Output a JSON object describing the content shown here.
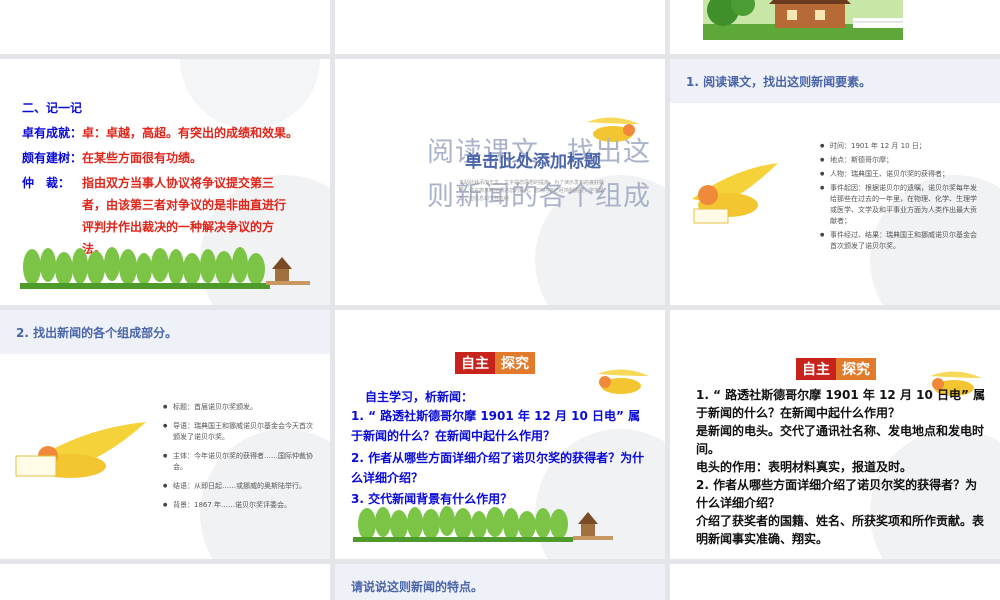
{
  "s3_note": "",
  "s4": {
    "heading": "二、记一记",
    "rows": [
      {
        "term": "卓有成就：",
        "def": "卓：卓越，高超。有突出的成绩和效果。"
      },
      {
        "term": "颇有建树：",
        "def": "在某些方面很有功绩。"
      },
      {
        "term": "仲　裁：",
        "def": "指由双方当事人协议将争议提交第三者，由该第三者对争议的是非曲直进行评判并作出裁决的一种解决争议的方法。"
      }
    ]
  },
  "s5": {
    "big_title": "阅读课文，找出这则新闻的各个组成",
    "click_title": "单击此处添加标题",
    "small_text": "本站此处添加正文，文字是您思想的提炼，为了演示发布的良好效果，请言简意赅地阐述您的观点。您的内容已经简明扼要，字字珠玑，但信息却千丝万缕"
  },
  "s6": {
    "title": "1. 阅读课文，找出这则新闻要素。",
    "bullets": [
      "时间：1901 年 12 月 10 日；",
      "地点：斯德哥尔摩；",
      "人物：瑞典国王、诺贝尔奖的获得者；",
      "事件起因：根据诺贝尔的遗嘱，诺贝尔奖每年发给那些在过去的一年里，在物理、化学、生理学或医学、文学及和平事业方面为人类作出最大贡献者；",
      "事件经过、结果：瑞典国王和挪威诺贝尔基金会首次颁发了诺贝尔奖。"
    ]
  },
  "s7": {
    "title": "2. 找出新闻的各个组成部分。",
    "bullets": [
      "标题：首届诺贝尔奖颁发。",
      "导语：瑞典国王和挪威诺贝尔基金会今天首次颁发了诺贝尔奖。",
      "主体：今年诺贝尔奖的获得者……国际仲裁协会。",
      "结语：从即日起……或挪威的奥斯陆举行。",
      "背景：1867 年……诺贝尔奖评委会。"
    ]
  },
  "s8": {
    "tag1": "自主",
    "tag2": "探究",
    "intro": "自主学习，析新闻：",
    "q1": "1. “ 路透社斯德哥尔摩  1901 年 12 月 10 日电” 属于新闻的什么？在新闻中起什么作用？",
    "q2": "2. 作者从哪些方面详细介绍了诺贝尔奖的获得者？为什么详细介绍？",
    "q3": "3. 交代新闻背景有什么作用？"
  },
  "s9": {
    "tag1": "自主",
    "tag2": "探究",
    "q1": "1. “ 路透社斯德哥尔摩  1901 年 12 月 10 日电” 属于新闻的什么？在新闻中起什么作用？",
    "a1": "是新闻的电头。交代了通讯社名称、发电地点和发电时间。",
    "a1b": "电头的作用：表明材料真实，报道及时。",
    "q2": "2. 作者从哪些方面详细介绍了诺贝尔奖的获得者？为什么详细介绍？",
    "a2": "介绍了获奖者的国籍、姓名、所获奖项和所作贡献。表明新闻事实准确、翔实。"
  },
  "s11": {
    "title": "请说说这则新闻的特点。"
  }
}
